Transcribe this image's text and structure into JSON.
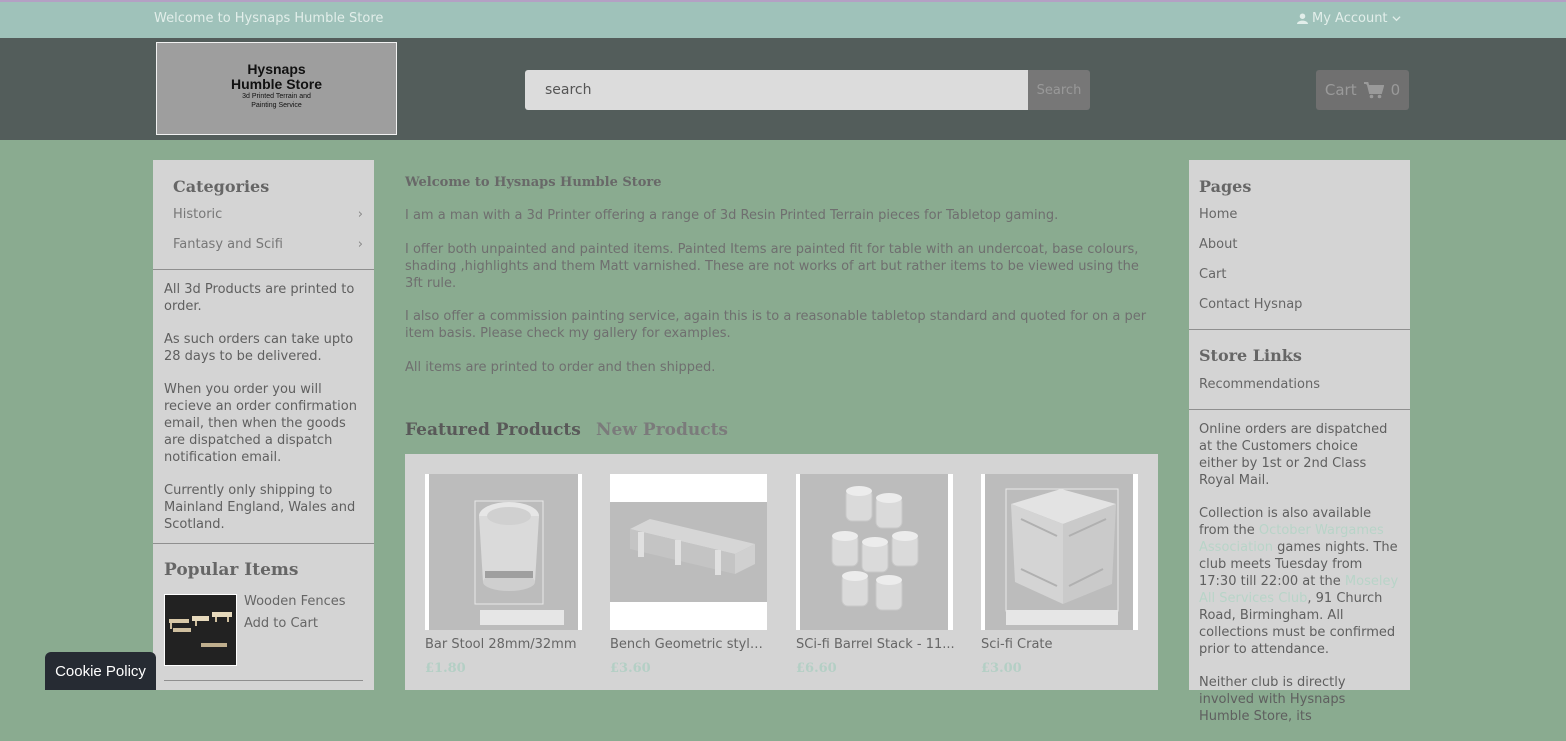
{
  "topbar": {
    "welcome": "Welcome to Hysnaps Humble Store",
    "account": "My Account"
  },
  "logo": {
    "line1": "Hysnaps",
    "line2": "Humble Store",
    "line3": "3d Printed Terrain and",
    "line4": "Painting Service"
  },
  "search": {
    "placeholder": "search",
    "button": "Search"
  },
  "cart": {
    "label": "Cart",
    "count": "0"
  },
  "left": {
    "categories_title": "Categories",
    "categories": [
      "Historic",
      "Fantasy and Scifi"
    ],
    "info": [
      "All 3d Products are printed to order.",
      "As such orders can take upto 28 days to be delivered.",
      "When you order you will recieve an order confirmation email, then when the goods are dispatched a dispatch notification email.",
      "Currently only shipping to Mainland England, Wales and Scotland."
    ],
    "popular_title": "Popular Items",
    "popular": {
      "name": "Wooden Fences",
      "action": "Add to Cart"
    }
  },
  "main": {
    "title": "Welcome to Hysnaps Humble Store",
    "paragraphs": [
      "I am a man with a 3d Printer offering a range of 3d Resin Printed Terrain pieces for Tabletop gaming.",
      "I offer both unpainted and painted items.  Painted Items are painted fit for table with an undercoat, base colours, shading ,highlights and them Matt varnished.  These are not works of art but rather items to be viewed using the 3ft rule.",
      "I also offer a commission painting service, again this is to a reasonable tabletop standard and quoted for on a per item basis.  Please check my gallery for examples.",
      "All items are printed to order and then shipped."
    ],
    "tabs": [
      "Featured Products",
      "New Products"
    ],
    "products": [
      {
        "name": "Bar Stool 28mm/32mm",
        "price": "£1.80"
      },
      {
        "name": "Bench Geometric style ...",
        "price": "£3.60"
      },
      {
        "name": "SCi-fi Barrel Stack - 11...",
        "price": "£6.60"
      },
      {
        "name": "Sci-fi Crate",
        "price": "£3.00"
      }
    ]
  },
  "right": {
    "pages_title": "Pages",
    "pages": [
      "Home",
      "About",
      "Cart",
      "Contact Hysnap"
    ],
    "store_links_title": "Store Links",
    "store_links": [
      "Recommendations"
    ],
    "dispatch": "Online orders are dispatched at the Customers choice either by 1st or 2nd Class Royal Mail.",
    "collection": {
      "p1": "Collection is also available from the ",
      "link1": "October Wargames Association",
      "p2": " games nights.  The club meets Tuesday from 17:30 till 22:00 at the ",
      "link2": "Moseley All Services Club",
      "p3": ", 91 Church Road, Birmingham.  All collections must be confirmed prior to attendance."
    },
    "disclaimer": "Neither club is directly involved with Hysnaps Humble Store, its"
  },
  "cookie": {
    "label": "Cookie Policy"
  },
  "colors": {
    "page_bg": "#8aab90",
    "topbar_bg": "#9fc2ba",
    "header_bg": "#535d5b",
    "price": "#b4cfc5",
    "link": "#b8d4c8"
  }
}
